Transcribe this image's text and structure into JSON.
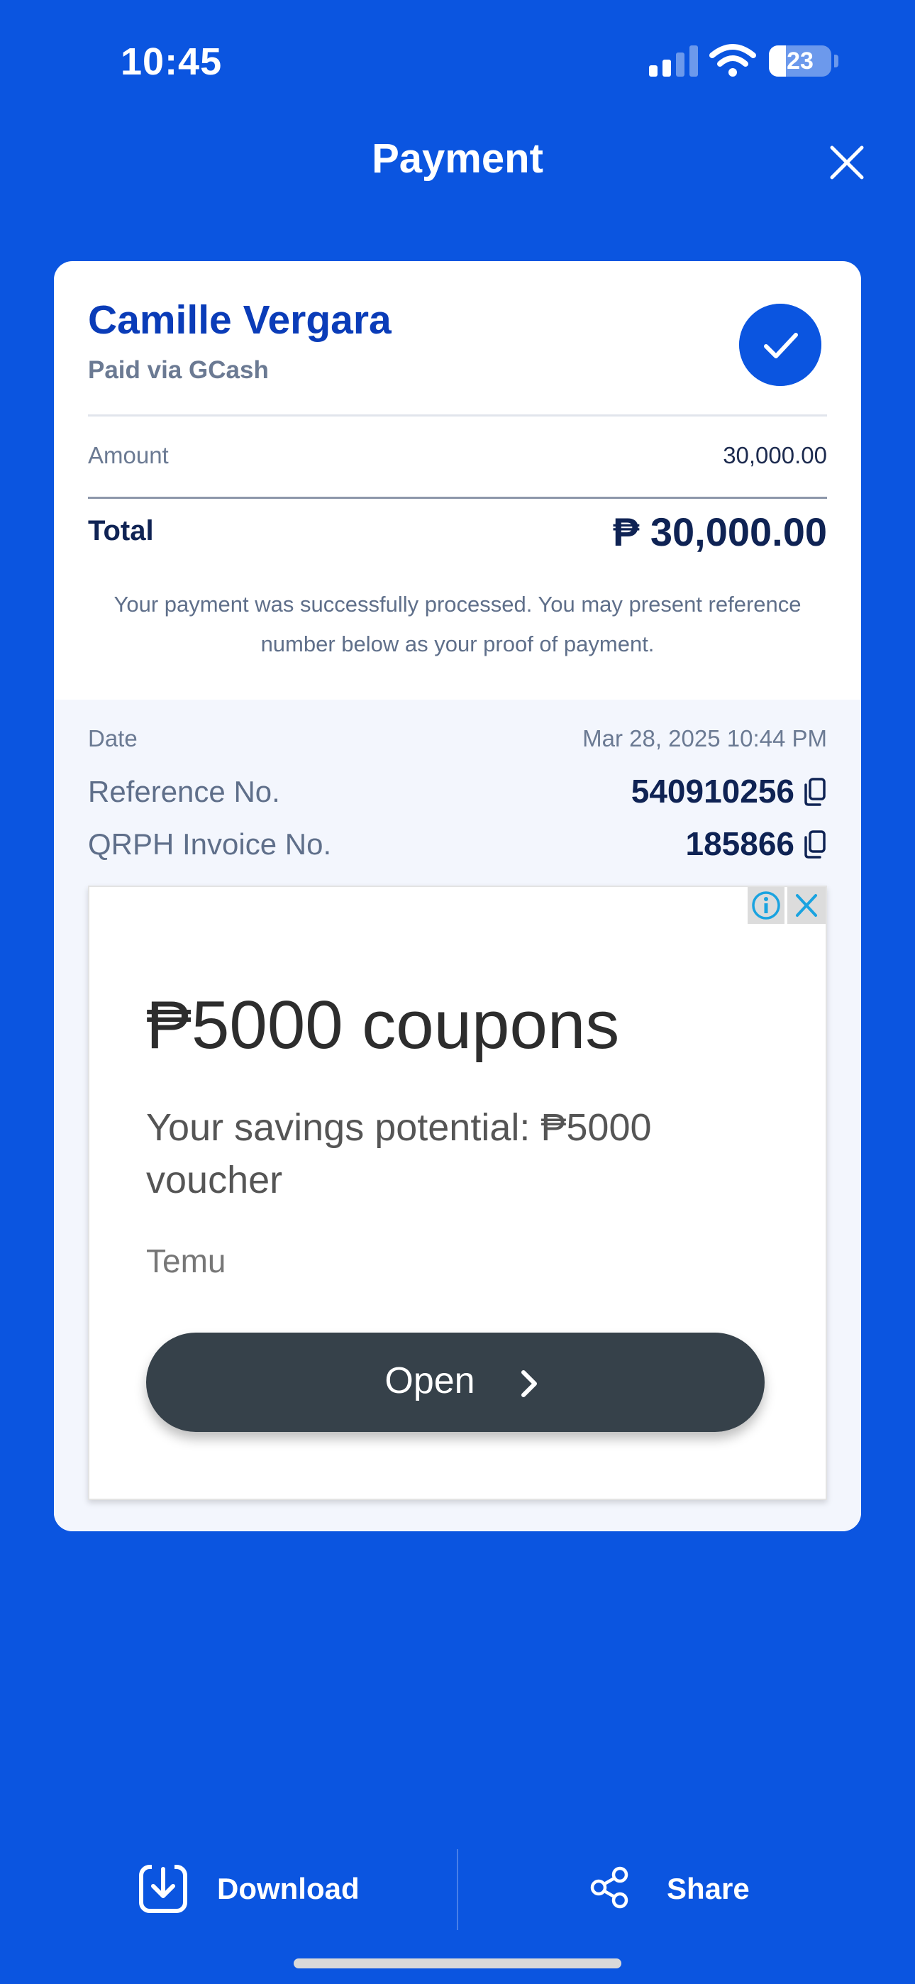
{
  "status_bar": {
    "time": "10:45",
    "battery": "23"
  },
  "header": {
    "title": "Payment",
    "close_icon": "close-icon"
  },
  "payment": {
    "payee_name": "Camille Vergara",
    "paid_via": "Paid via GCash",
    "amount_label": "Amount",
    "amount_value": "30,000.00",
    "total_label": "Total",
    "total_value": "₱ 30,000.00",
    "message": "Your payment was successfully processed. You may present reference number below as your proof of payment."
  },
  "details": {
    "date_label": "Date",
    "date_value": "Mar 28, 2025 10:44 PM",
    "reference_label": "Reference No.",
    "reference_value": "540910256",
    "invoice_label": "QRPH Invoice No.",
    "invoice_value": "185866"
  },
  "ad": {
    "title": "₱5000 coupons",
    "subtitle": "Your savings potential: ₱5000 voucher",
    "brand": "Temu",
    "button_label": "Open"
  },
  "bottom_bar": {
    "download_label": "Download",
    "share_label": "Share"
  },
  "colors": {
    "primary": "#0b55e0",
    "navy": "#0f2354",
    "card": "#ffffff"
  }
}
